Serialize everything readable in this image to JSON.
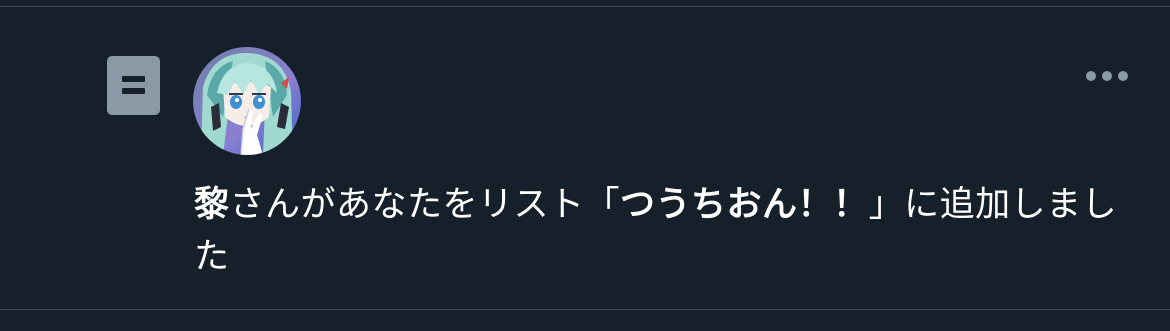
{
  "notification": {
    "icon": "list-icon",
    "avatar": {
      "icon": "user-avatar",
      "colors": {
        "hair": "#9fd9d0",
        "hair_shadow": "#5aa9a8",
        "skin": "#f6ece8",
        "eye": "#3f8fd1",
        "bg": "#7a88c8"
      }
    },
    "menu_icon": "more-horizontal-icon",
    "message": {
      "user_name": "黎",
      "text_before_list": "さんがあなたをリスト",
      "open_bracket": "「",
      "list_name": "つうちおん！！",
      "close_bracket": "」",
      "text_after_list": "に追加しました"
    }
  },
  "colors": {
    "background": "#15202b",
    "divider": "#38444d",
    "secondary": "#8b98a5",
    "text": "#ffffff"
  }
}
